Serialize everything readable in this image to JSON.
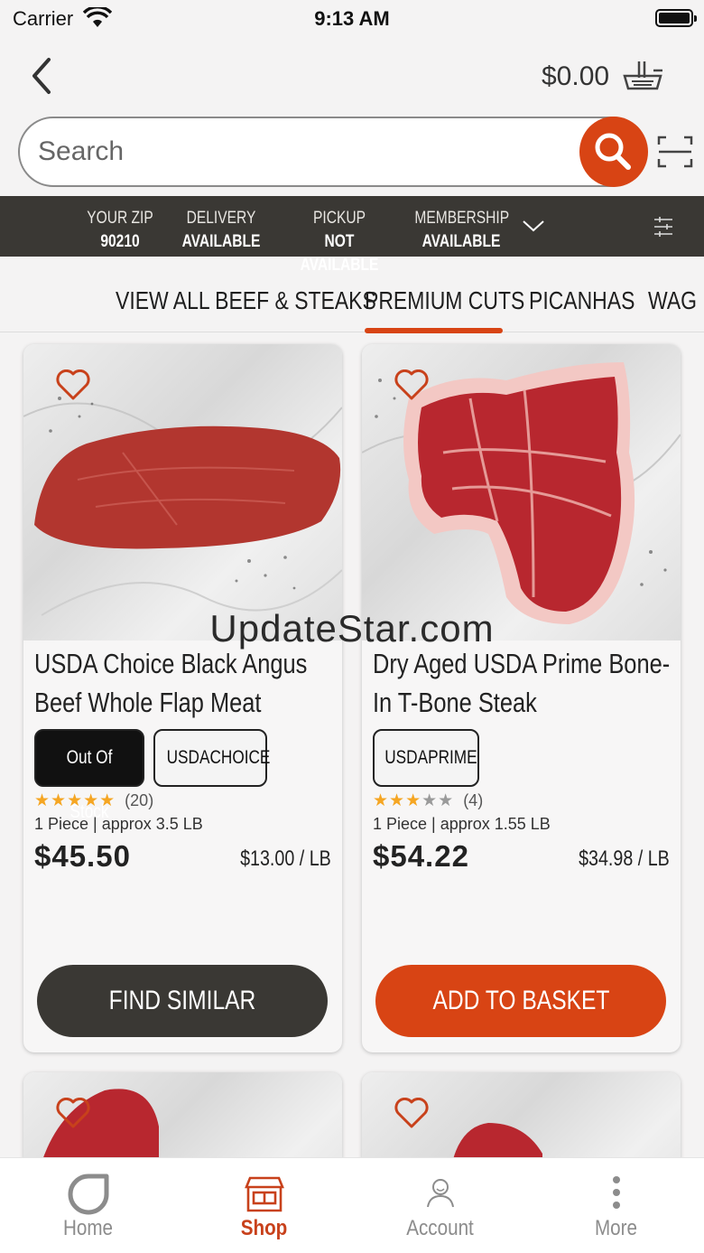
{
  "status_bar": {
    "carrier": "Carrier",
    "time": "9:13 AM"
  },
  "header": {
    "cart_total": "$0.00"
  },
  "search": {
    "placeholder": "Search"
  },
  "info_bar": {
    "zip_label": "YOUR ZIP",
    "zip_value": "90210",
    "delivery_label": "DELIVERY",
    "delivery_value": "AVAILABLE",
    "pickup_label": "PICKUP",
    "pickup_value": "NOT AVAILABLE",
    "membership_label": "MEMBERSHIP",
    "membership_value": "AVAILABLE"
  },
  "tabs": {
    "items": [
      "VIEW ALL BEEF & STEAKS",
      "PREMIUM CUTS",
      "PICANHAS",
      "WAG"
    ],
    "active": "PREMIUM CUTS"
  },
  "products": [
    {
      "title_line1": "USDA Choice Black Angus",
      "title_line2": "Beef Whole Flap Meat",
      "badges": [
        "Out Of Stock",
        "USDACHOICE"
      ],
      "rating": 5,
      "review_count": "(20)",
      "quantity": "1 Piece | approx 3.5 LB",
      "price": "$45.50",
      "unit_price": "$13.00 / LB",
      "action": "FIND SIMILAR PRODUCTS"
    },
    {
      "title_line1": "Dry Aged USDA Prime Bone-",
      "title_line2": "In T-Bone Steak",
      "badges": [
        "USDAPRIME"
      ],
      "rating": 3,
      "review_count": "(4)",
      "quantity": "1 Piece | approx 1.55 LB",
      "price": "$54.22",
      "unit_price": "$34.98 / LB",
      "action": "ADD TO BASKET"
    }
  ],
  "watermark": "UpdateStar.com",
  "bottom_nav": [
    {
      "label": "Home",
      "icon": "home-icon"
    },
    {
      "label": "Shop",
      "icon": "shop-icon",
      "active": true
    },
    {
      "label": "Account",
      "icon": "account-icon"
    },
    {
      "label": "More",
      "icon": "more-icon"
    }
  ],
  "colors": {
    "accent": "#d84414",
    "dark": "#3a3834",
    "star": "#f5a623"
  }
}
